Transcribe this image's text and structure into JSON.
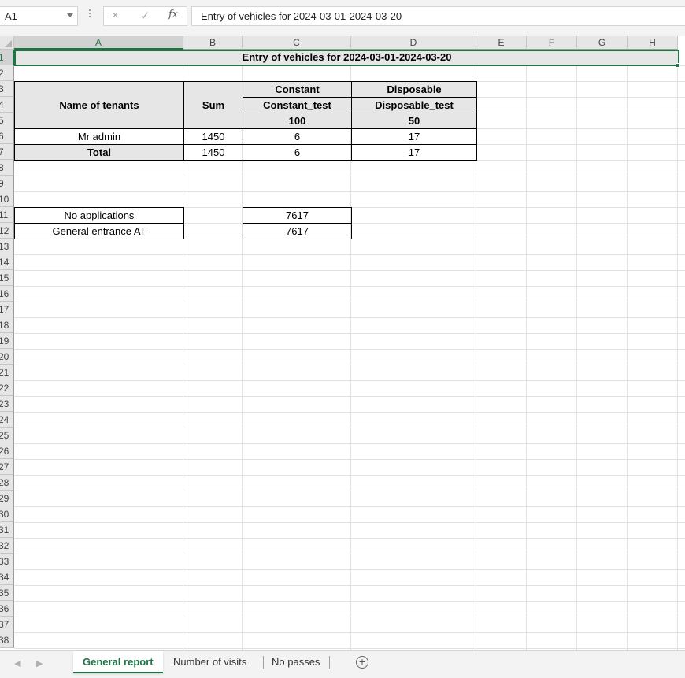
{
  "formula_bar": {
    "name_box": "A1",
    "cancel_icon": "×",
    "enter_icon": "✓",
    "fx_icon": "fx",
    "formula": "Entry of vehicles for 2024-03-01-2024-03-20"
  },
  "columns": [
    "A",
    "B",
    "C",
    "D",
    "E",
    "F",
    "G",
    "H"
  ],
  "rows": [
    "1",
    "2",
    "3",
    "4",
    "5",
    "6",
    "7",
    "8",
    "9",
    "10",
    "11",
    "12",
    "13",
    "14",
    "15",
    "16",
    "17",
    "18",
    "19",
    "20",
    "21",
    "22",
    "23",
    "24",
    "25",
    "26",
    "27",
    "28",
    "29",
    "30",
    "31",
    "32",
    "33",
    "34",
    "35",
    "36",
    "37",
    "38"
  ],
  "report": {
    "title": "Entry of vehicles for 2024-03-01-2024-03-20",
    "header": {
      "tenant_col": "Name of tenants",
      "sum_col": "Sum",
      "c_category": "Constant",
      "d_category": "Disposable",
      "c_sub": "Constant_test",
      "d_sub": "Disposable_test",
      "c_price": "100",
      "d_price": "50"
    },
    "row6": {
      "name": "Mr admin",
      "sum": "1450",
      "c": "6",
      "d": "17"
    },
    "row7": {
      "name": "Total",
      "sum": "1450",
      "c": "6",
      "d": "17"
    },
    "row11": {
      "label": "No applications",
      "value": "7617"
    },
    "row12": {
      "label": "General entrance AT",
      "value": "7617"
    }
  },
  "sheet_tabs": {
    "active": "General report",
    "tab2": "Number of visits",
    "tab3": "No passes",
    "add": "+"
  }
}
